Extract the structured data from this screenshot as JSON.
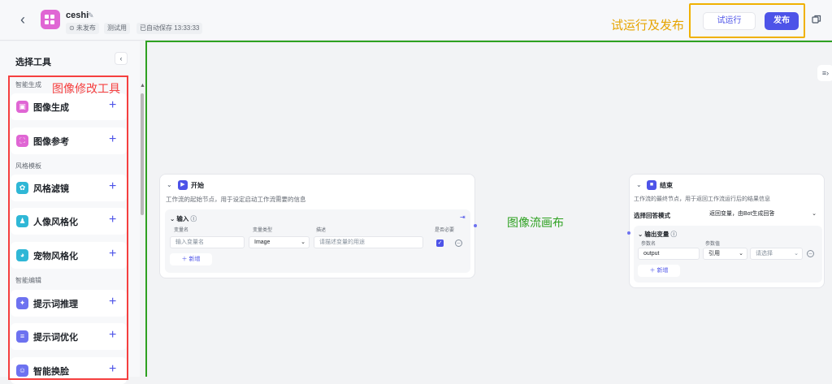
{
  "header": {
    "title": "ceshi",
    "status": "⊙ 未发布",
    "tag": "测试用",
    "autosave": "已自动保存 13:33:33",
    "annotation": "试运行及发布",
    "run_label": "试运行",
    "publish_label": "发布"
  },
  "sidebar": {
    "title": "选择工具",
    "annotation": "图像修改工具",
    "groups": [
      {
        "label": "智能生成",
        "items": [
          {
            "label": "图像生成",
            "color": "#e066d4"
          },
          {
            "label": "图像参考",
            "color": "#e066d4"
          }
        ]
      },
      {
        "label": "风格模板",
        "items": [
          {
            "label": "风格滤镜",
            "color": "#2fb7d6"
          },
          {
            "label": "人像风格化",
            "color": "#2fb7d6"
          },
          {
            "label": "宠物风格化",
            "color": "#2fb7d6"
          }
        ]
      },
      {
        "label": "智能编辑",
        "items": [
          {
            "label": "提示词推理",
            "color": "#6d72f0"
          },
          {
            "label": "提示词优化",
            "color": "#6d72f0"
          },
          {
            "label": "智能换脸",
            "color": "#6d72f0"
          }
        ]
      }
    ]
  },
  "canvas": {
    "annotation": "图像流画布",
    "start_node": {
      "title": "开始",
      "desc": "工作流的起始节点，用于设定启动工作流需要的信息",
      "section": "输入",
      "col_name": "变量名",
      "col_type": "变量类型",
      "col_desc": "描述",
      "col_required": "是否必要",
      "name_placeholder": "输入变量名",
      "type_value": "Image",
      "desc_placeholder": "请描述变量的用途",
      "add_label": "新增"
    },
    "end_node": {
      "title": "结束",
      "desc": "工作流的最终节点，用于返回工作流运行后的结果信息",
      "mode_label": "选择回答模式",
      "mode_value": "返回变量，由Bot生成回答",
      "section": "输出变量",
      "col_name": "参数名",
      "col_value": "参数值",
      "param_name": "output",
      "ref_value": "引用",
      "select_placeholder": "请选择",
      "add_label": "新增"
    }
  }
}
